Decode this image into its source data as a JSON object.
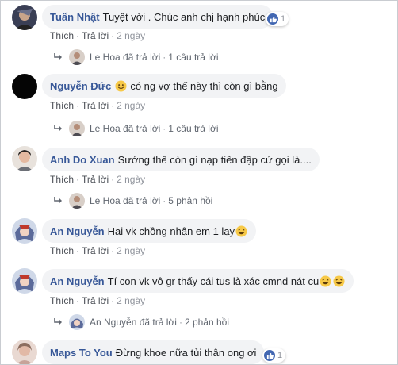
{
  "comments": [
    {
      "author": "Tuấn Nhật",
      "text": "Tuyệt vời . Chúc anh chị hạnh phúc",
      "like_count": "1",
      "actions": {
        "like": "Thích",
        "reply": "Trả lời",
        "time": "2 ngày"
      },
      "reply_summary": {
        "name": "Le Hoa",
        "verb": "đã trả lời",
        "count": "1 câu trả lời"
      }
    },
    {
      "author": "Nguyễn Đức",
      "text": "có ng vợ thế này thì còn gì bằng",
      "actions": {
        "like": "Thích",
        "reply": "Trả lời",
        "time": "2 ngày"
      },
      "reply_summary": {
        "name": "Le Hoa",
        "verb": "đã trả lời",
        "count": "1 câu trả lời"
      }
    },
    {
      "author": "Anh Do Xuan",
      "text": "Sướng thế còn gì nạp tiền đập cứ gọi là....",
      "actions": {
        "like": "Thích",
        "reply": "Trả lời",
        "time": "2 ngày"
      },
      "reply_summary": {
        "name": "Le Hoa",
        "verb": "đã trả lời",
        "count": "5 phản hồi"
      }
    },
    {
      "author": "An Nguyễn",
      "text": "Hai vk chồng nhận em 1 lạy",
      "actions": {
        "like": "Thích",
        "reply": "Trả lời",
        "time": "2 ngày"
      }
    },
    {
      "author": "An Nguyễn",
      "text": "Tí con vk vô gr thấy cái tus là xác cmnd nát cu",
      "actions": {
        "like": "Thích",
        "reply": "Trả lời",
        "time": "2 ngày"
      },
      "reply_summary": {
        "name": "An Nguyễn",
        "verb": "đã trả lời",
        "count": "2 phản hồi"
      }
    },
    {
      "author": "Maps To You",
      "text": "Đừng khoe nữa tủi thân ong ơi",
      "like_count": "1"
    }
  ],
  "colors": {
    "author": "#385898",
    "bubble": "#f2f3f5",
    "like": "#4267b2",
    "meta": "#90949c"
  },
  "icons": [
    "reply-arrow-icon",
    "like-thumb-icon",
    "smiley-emoji-icon",
    "laughing-emoji-icon"
  ]
}
